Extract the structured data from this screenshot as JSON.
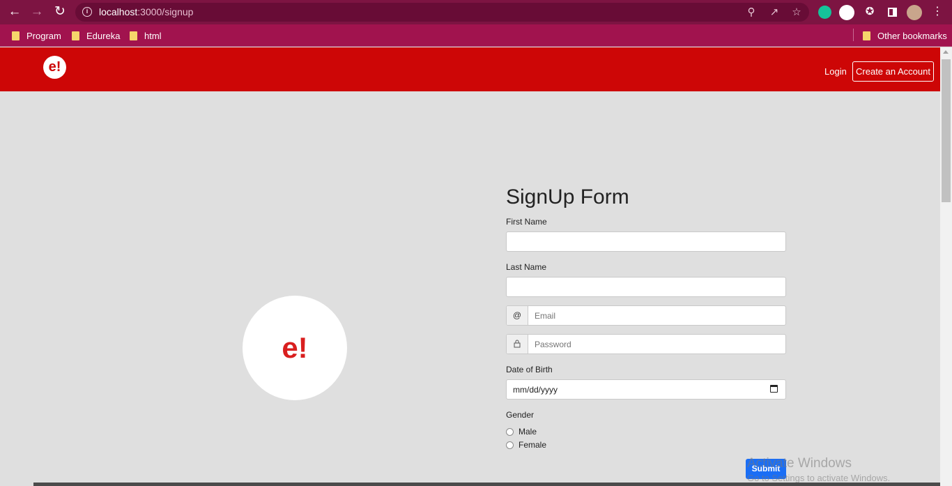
{
  "browser": {
    "url_host": "localhost",
    "url_path": ":3000/signup",
    "bookmarks": [
      "Program",
      "Edureka",
      "html"
    ],
    "other_bookmarks": "Other bookmarks"
  },
  "header": {
    "logo": "e!",
    "login": "Login",
    "create_account": "Create an Account"
  },
  "hero_logo": "e!",
  "form": {
    "title": "SignUp Form",
    "first_name_label": "First Name",
    "first_name_value": "",
    "last_name_label": "Last Name",
    "last_name_value": "",
    "email_addon": "@",
    "email_placeholder": "Email",
    "password_placeholder": "Password",
    "dob_label": "Date of Birth",
    "dob_placeholder": "mm/dd/yyyy",
    "gender_label": "Gender",
    "gender_options": [
      "Male",
      "Female"
    ],
    "submit": "Submit"
  },
  "watermark": {
    "line1": "Activate Windows",
    "line2": "Go to Settings to activate Windows."
  },
  "colors": {
    "browser_top": "#7d1442",
    "bookmark_bar": "#a1134e",
    "site_header": "#cd0606",
    "submit": "#1a6ef5"
  }
}
